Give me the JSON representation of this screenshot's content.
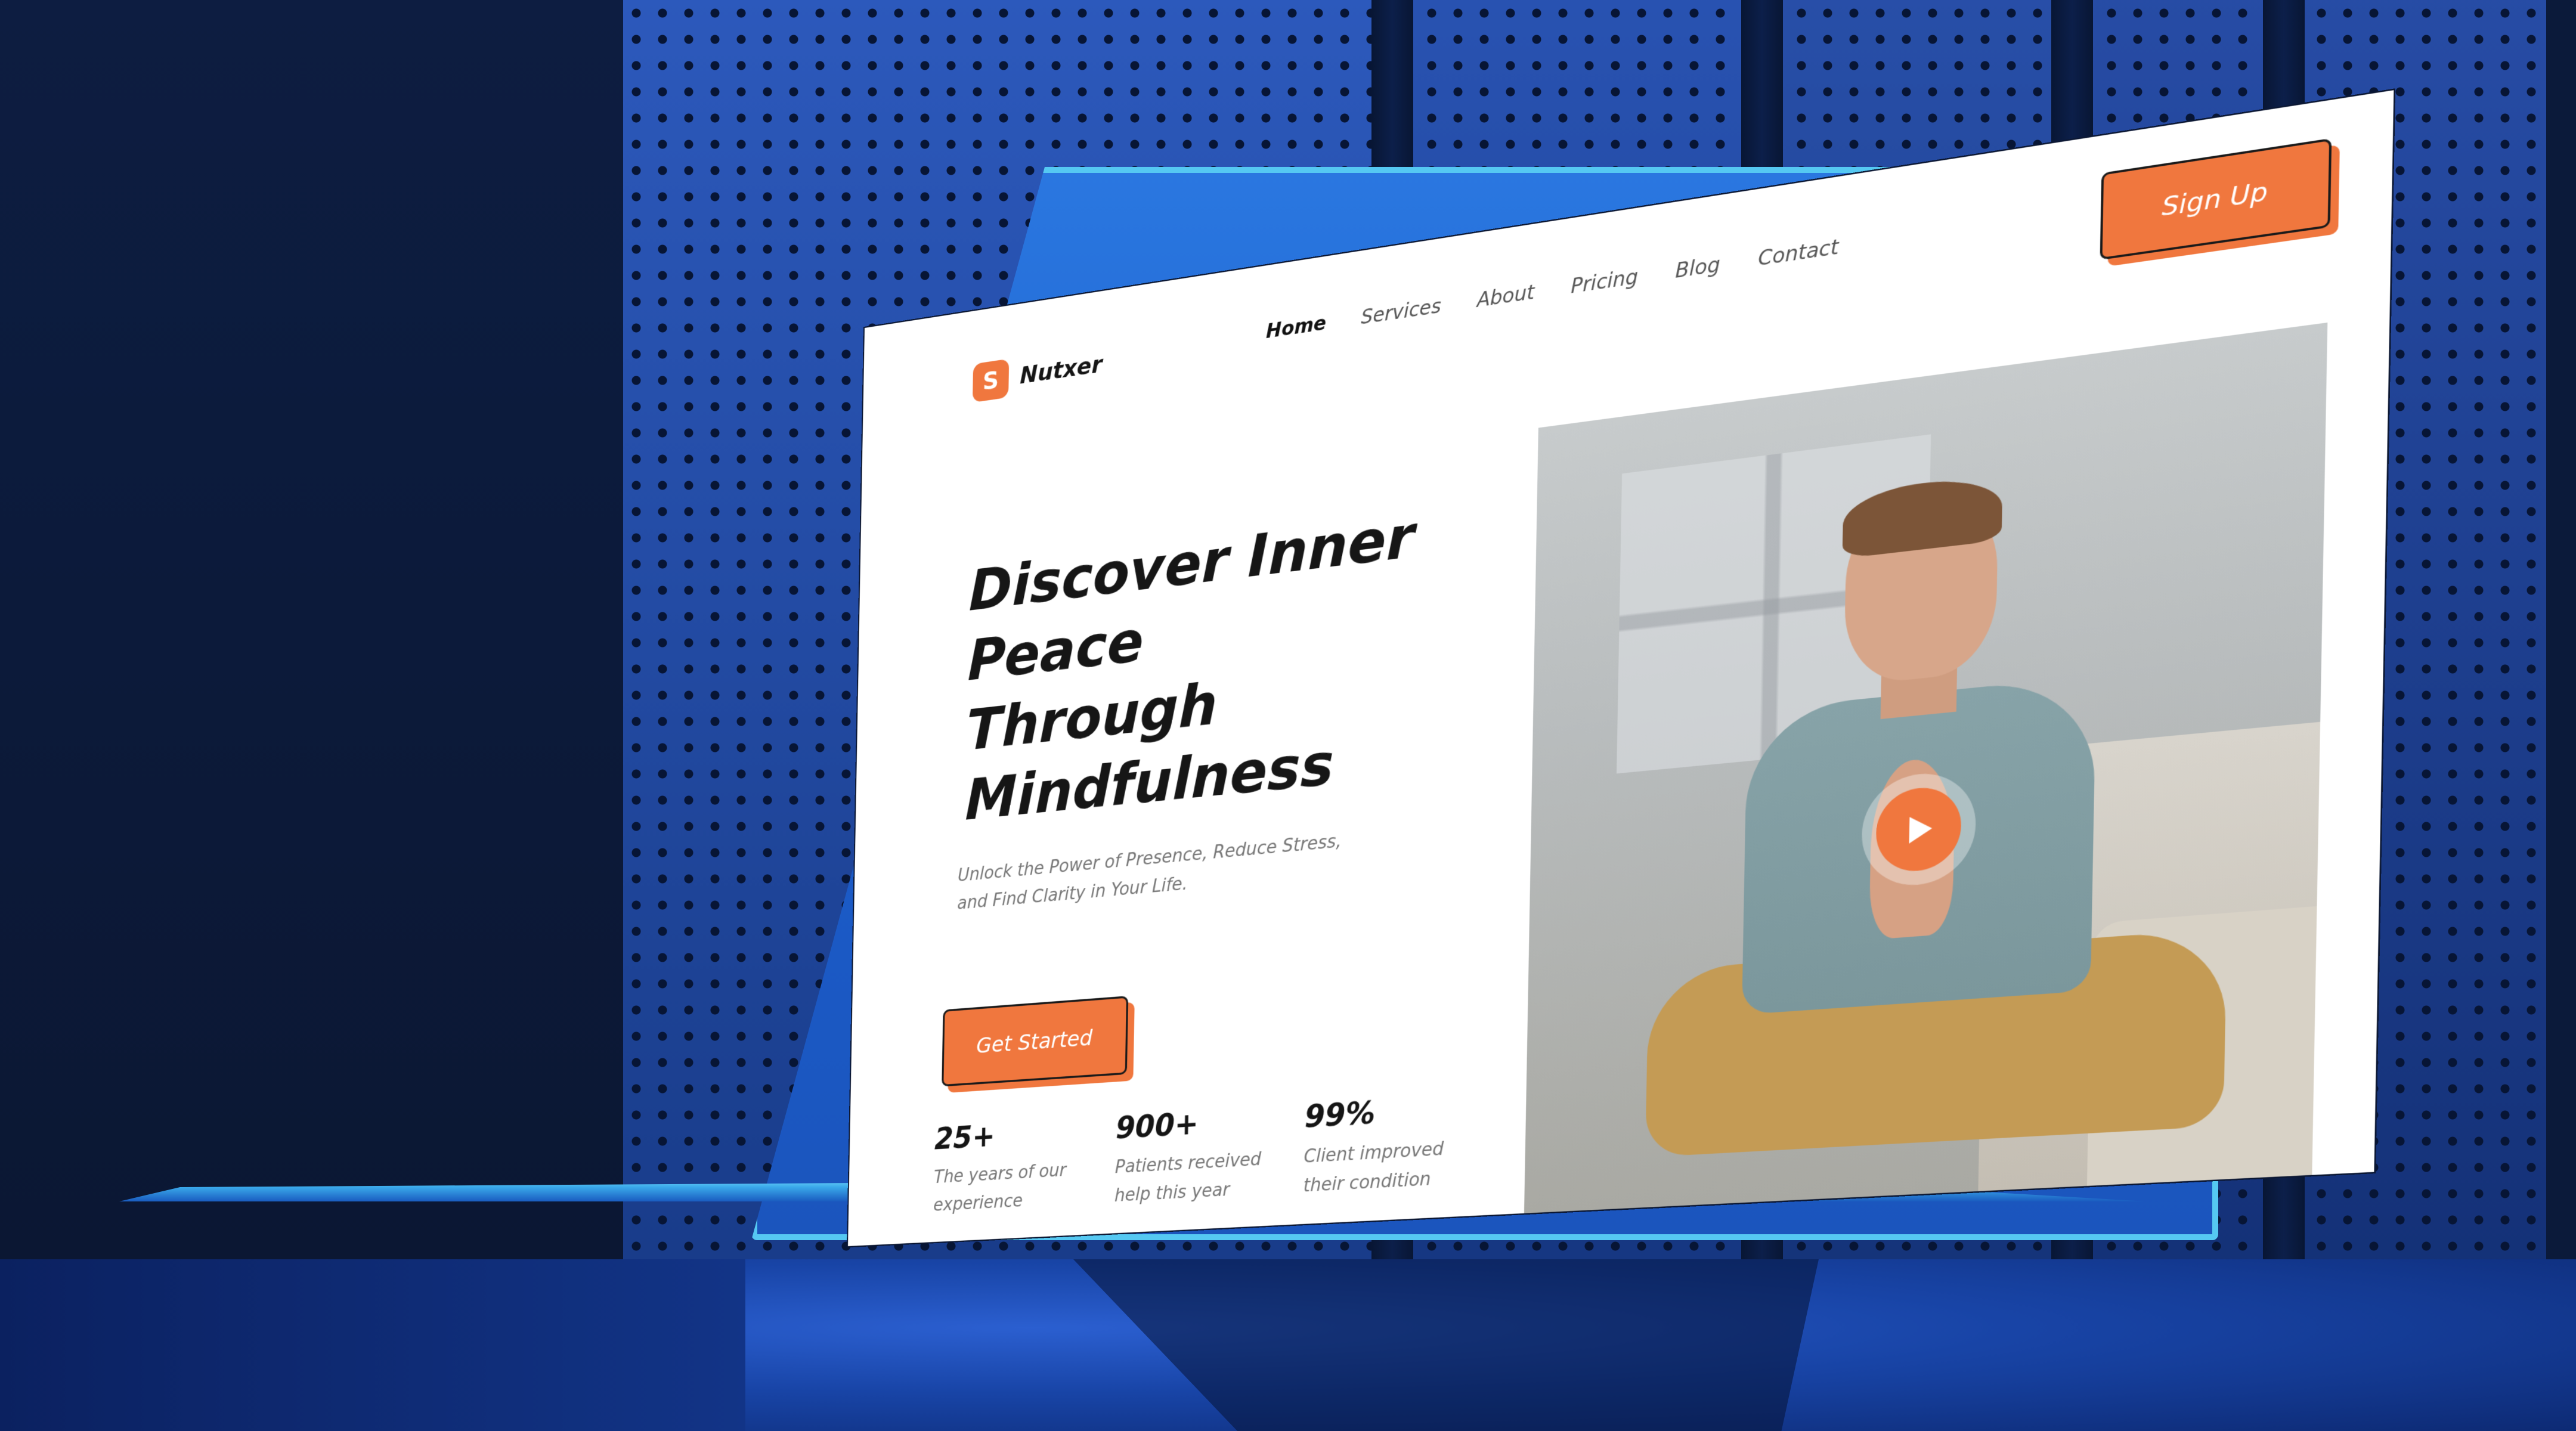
{
  "site": {
    "brand": "Nutxer",
    "logo_glyph": "S",
    "nav": {
      "items": [
        "Home",
        "Services",
        "About",
        "Pricing",
        "Blog",
        "Contact"
      ],
      "active": "Home"
    },
    "signup_label": "Sign Up",
    "hero": {
      "title_lines": [
        "Discover Inner",
        "Peace Through",
        "Mindfulness"
      ],
      "subtitle": "Unlock the Power of Presence, Reduce Stress, and Find Clarity in Your Life.",
      "cta_label": "Get Started"
    },
    "stats": [
      {
        "value": "25+",
        "label": "The years of our experience"
      },
      {
        "value": "900+",
        "label": "Patients received help this year"
      },
      {
        "value": "99%",
        "label": "Client improved their condition"
      }
    ],
    "media": {
      "play_icon": "play-icon"
    }
  },
  "colors": {
    "accent": "#f0773e",
    "text_dark": "#161616",
    "text_muted": "#777777",
    "background_blue": "#1b48a8",
    "laptop_edge": "#55c8f2"
  }
}
